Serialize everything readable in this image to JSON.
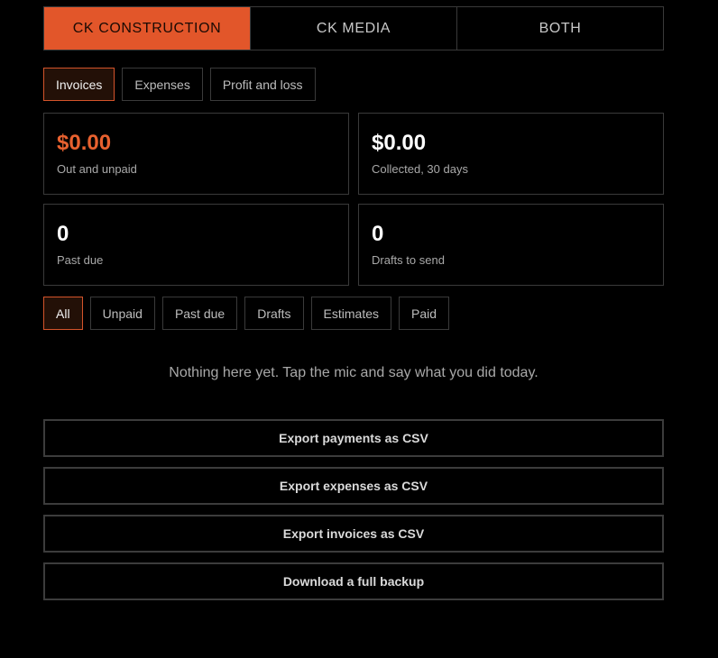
{
  "business_switch": {
    "tabs": [
      {
        "label": "CK CONSTRUCTION",
        "active": true
      },
      {
        "label": "CK MEDIA",
        "active": false
      },
      {
        "label": "BOTH",
        "active": false
      }
    ]
  },
  "section_tabs": [
    {
      "label": "Invoices",
      "active": true
    },
    {
      "label": "Expenses",
      "active": false
    },
    {
      "label": "Profit and loss",
      "active": false
    }
  ],
  "stats": [
    {
      "value": "$0.00",
      "label": "Out and unpaid",
      "accent": true
    },
    {
      "value": "$0.00",
      "label": "Collected, 30 days",
      "accent": false
    },
    {
      "value": "0",
      "label": "Past due",
      "accent": false
    },
    {
      "value": "0",
      "label": "Drafts to send",
      "accent": false
    }
  ],
  "filters": [
    {
      "label": "All",
      "active": true
    },
    {
      "label": "Unpaid",
      "active": false
    },
    {
      "label": "Past due",
      "active": false
    },
    {
      "label": "Drafts",
      "active": false
    },
    {
      "label": "Estimates",
      "active": false
    },
    {
      "label": "Paid",
      "active": false
    }
  ],
  "empty_state": "Nothing here yet. Tap the mic and say what you did today.",
  "actions": [
    "Export payments as CSV",
    "Export expenses as CSV",
    "Export invoices as CSV",
    "Download a full backup"
  ],
  "colors": {
    "accent": "#e2562a",
    "background": "#000000",
    "border": "#3a3a3a"
  }
}
